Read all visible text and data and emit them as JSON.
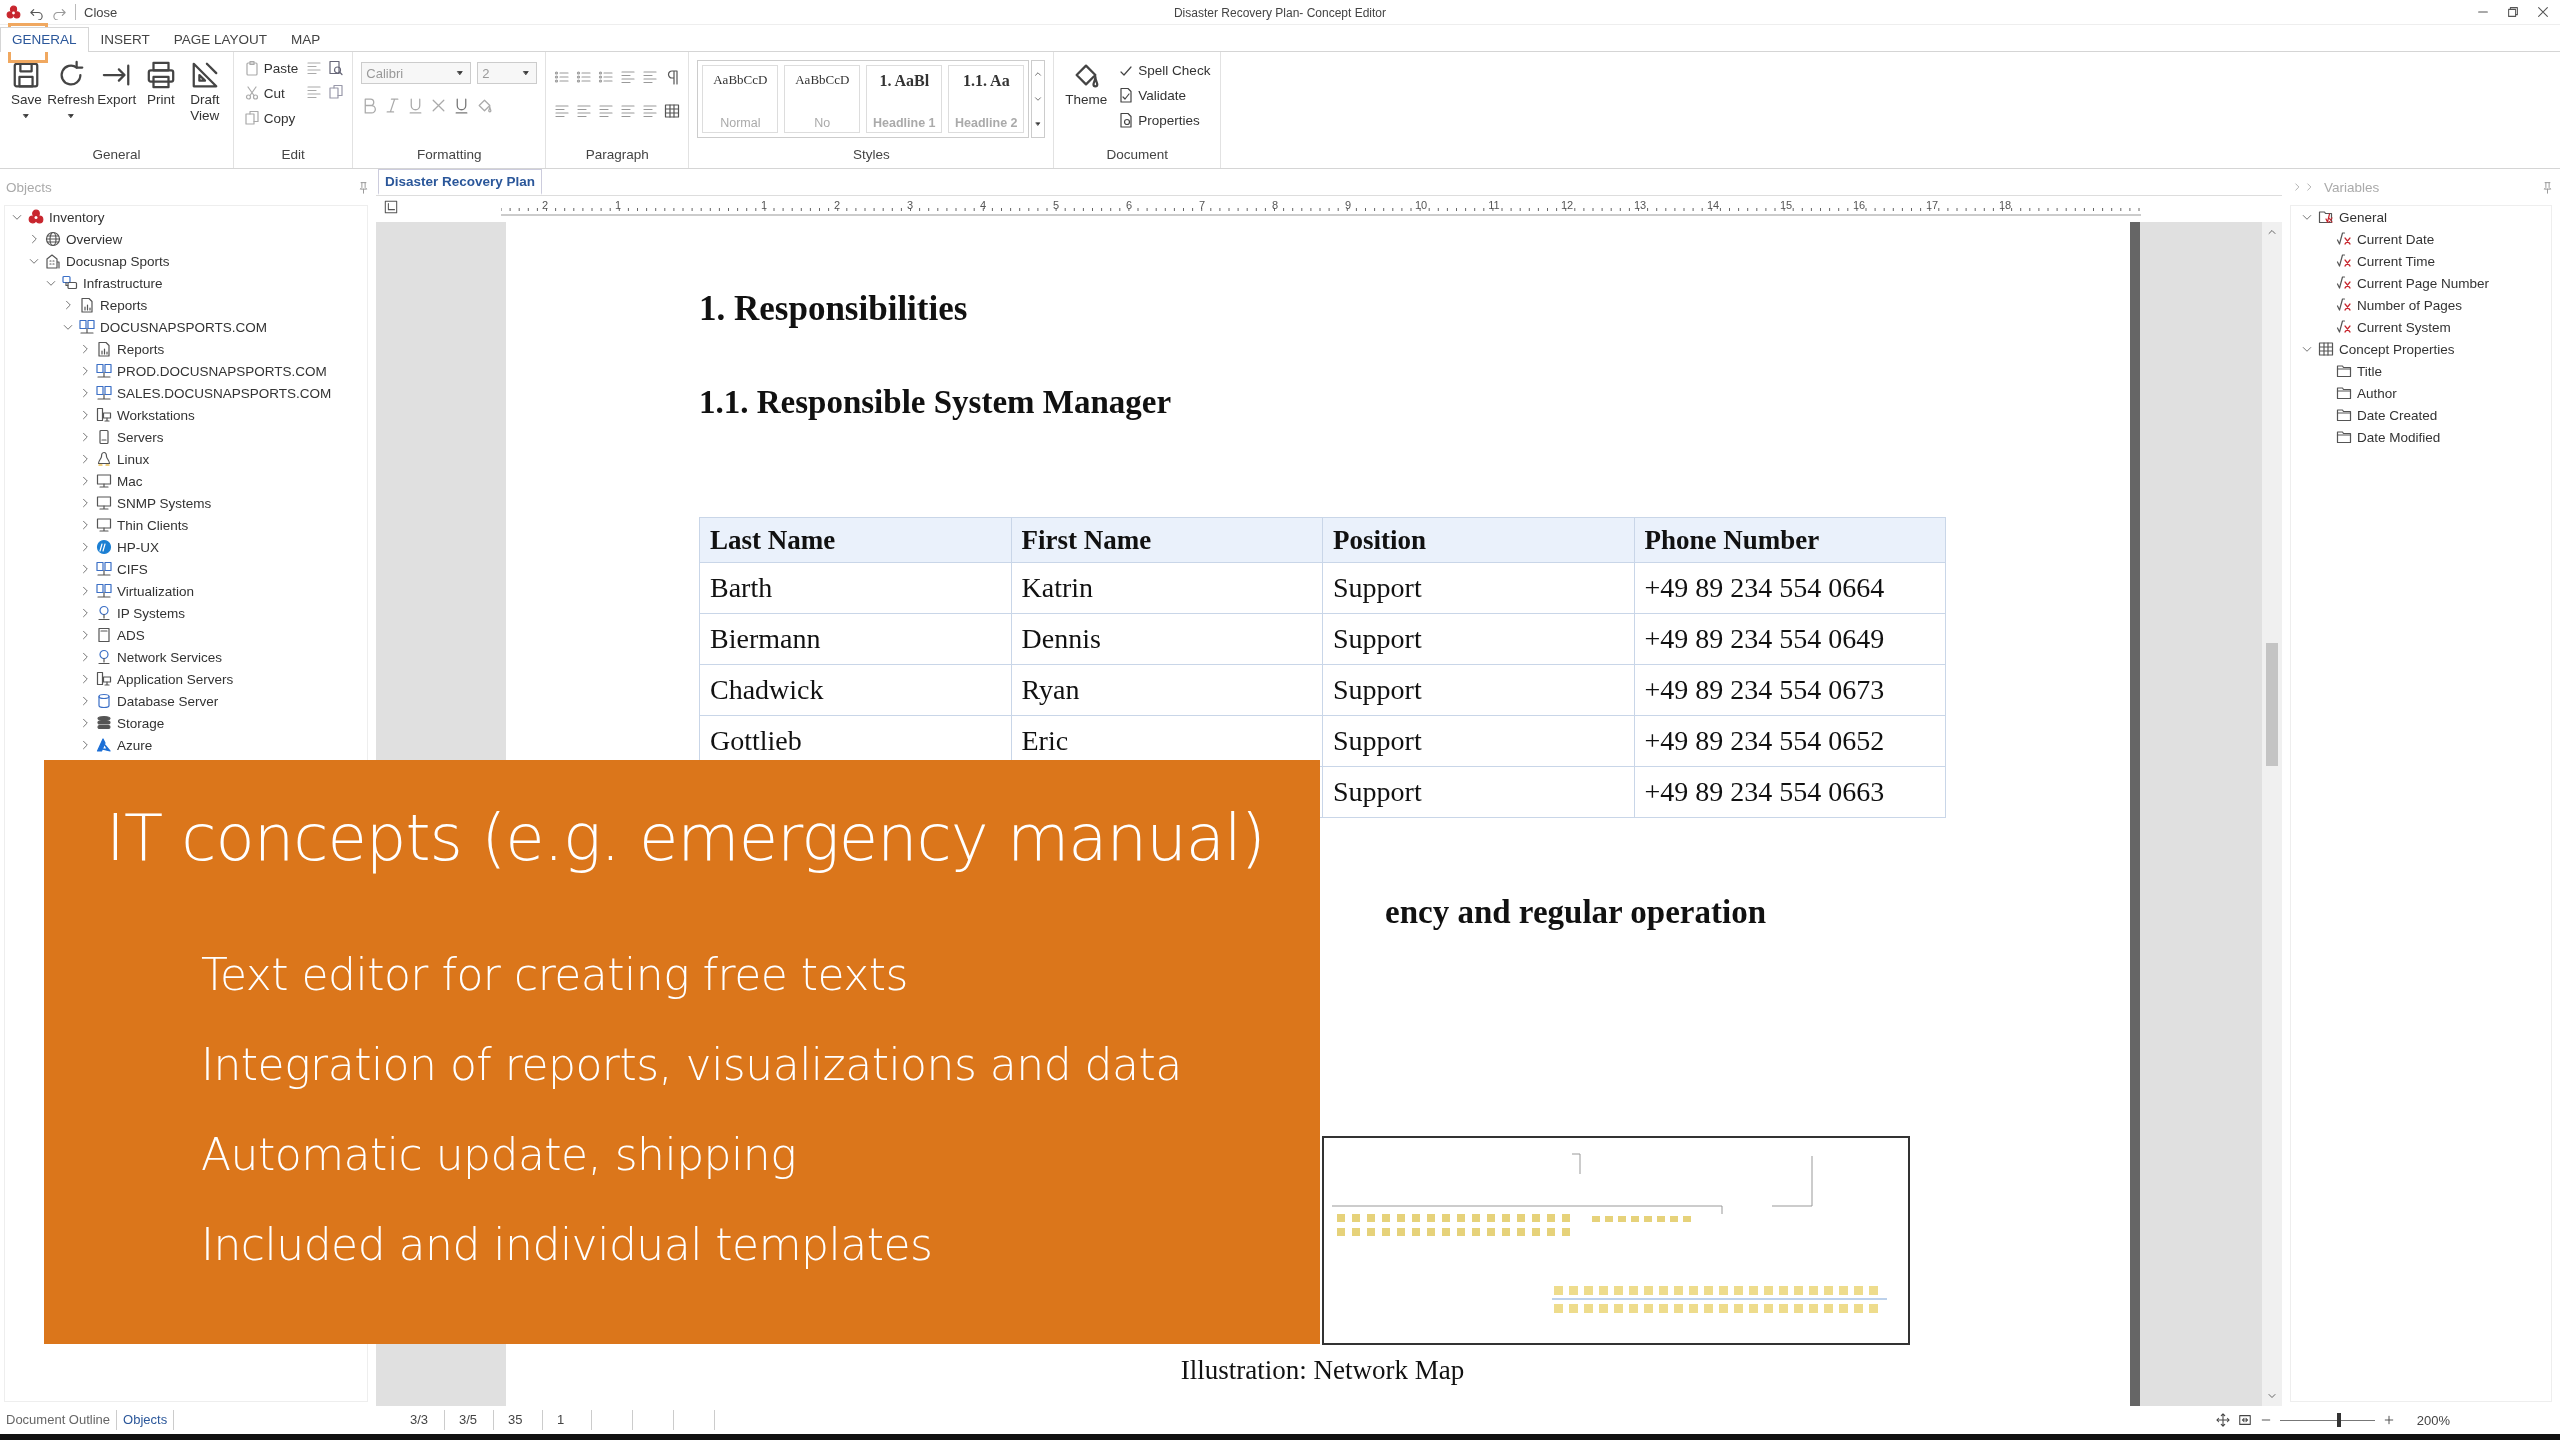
{
  "window": {
    "title": "Disaster Recovery Plan- Concept Editor",
    "quick_access": "Close"
  },
  "ribbon_tabs": [
    {
      "label": "GENERAL",
      "selected": true
    },
    {
      "label": "INSERT",
      "selected": false
    },
    {
      "label": "PAGE LAYOUT",
      "selected": false
    },
    {
      "label": "MAP",
      "selected": false
    }
  ],
  "ribbon": {
    "groups": [
      {
        "label": "General",
        "kind": "large",
        "items": [
          {
            "label": "Save",
            "kind": "save",
            "dropdown": true,
            "disabled": false
          },
          {
            "label": "Refresh",
            "kind": "refresh",
            "dropdown": true,
            "disabled": false
          },
          {
            "label": "Export",
            "kind": "export",
            "dropdown": false,
            "disabled": false
          },
          {
            "label": "Print",
            "kind": "print",
            "dropdown": false,
            "disabled": false
          },
          {
            "label": "Draft View",
            "kind": "draft",
            "dropdown": false,
            "disabled": false
          }
        ]
      },
      {
        "label": "Edit",
        "kind": "edit",
        "items": [
          {
            "label": "Paste",
            "kind": "paste",
            "disabled": true
          },
          {
            "label": "Cut",
            "kind": "cut",
            "disabled": true
          },
          {
            "label": "Copy",
            "kind": "copy",
            "disabled": true
          }
        ]
      },
      {
        "label": "Formatting",
        "kind": "format",
        "font": "Calibri",
        "size": "2",
        "disabled": true
      },
      {
        "label": "Paragraph",
        "kind": "paragraph"
      },
      {
        "label": "Styles",
        "kind": "styles",
        "items": [
          {
            "preview": "AaBbCcD",
            "label": "Normal",
            "bold": false
          },
          {
            "preview": "AaBbCcD",
            "label": "No",
            "bold": false
          },
          {
            "preview": "1. AaBl",
            "label": "Headline 1",
            "bold": true
          },
          {
            "preview": "1.1. Aa",
            "label": "Headline 2",
            "bold": true
          }
        ]
      },
      {
        "label": "Document",
        "kind": "document",
        "items": [
          {
            "label": "Theme",
            "kind": "theme"
          },
          {
            "label": "Spell Check",
            "kind": "spell"
          },
          {
            "label": "Validate",
            "kind": "validate"
          },
          {
            "label": "Properties",
            "kind": "properties"
          }
        ]
      }
    ]
  },
  "objects": {
    "title": "Objects",
    "items": [
      {
        "label": "Inventory",
        "kind": "root",
        "expanded": true,
        "children": [
          {
            "label": "Overview",
            "kind": "globe",
            "expanded": false
          },
          {
            "label": "Docusnap Sports",
            "kind": "building",
            "expanded": true,
            "children": [
              {
                "label": "Infrastructure",
                "kind": "network",
                "expanded": true,
                "children": [
                  {
                    "label": "Reports",
                    "kind": "report",
                    "expanded": false
                  },
                  {
                    "label": "DOCUSNAPSPORTS.COM",
                    "kind": "domain",
                    "expanded": true,
                    "children": [
                      {
                        "label": "Reports",
                        "kind": "report",
                        "expanded": false
                      },
                      {
                        "label": "PROD.DOCUSNAPSPORTS.COM",
                        "kind": "domain",
                        "expanded": false
                      },
                      {
                        "label": "SALES.DOCUSNAPSPORTS.COM",
                        "kind": "domain",
                        "expanded": false
                      },
                      {
                        "label": "Workstations",
                        "kind": "workstation",
                        "expanded": false
                      },
                      {
                        "label": "Servers",
                        "kind": "server",
                        "expanded": false
                      },
                      {
                        "label": "Linux",
                        "kind": "linux",
                        "expanded": false
                      },
                      {
                        "label": "Mac",
                        "kind": "monitor",
                        "expanded": false
                      },
                      {
                        "label": "SNMP Systems",
                        "kind": "monitor",
                        "expanded": false
                      },
                      {
                        "label": "Thin Clients",
                        "kind": "monitor",
                        "expanded": false
                      },
                      {
                        "label": "HP-UX",
                        "kind": "hp",
                        "expanded": false
                      },
                      {
                        "label": "CIFS",
                        "kind": "domain",
                        "expanded": false
                      },
                      {
                        "label": "Virtualization",
                        "kind": "domain",
                        "expanded": false
                      },
                      {
                        "label": "IP Systems",
                        "kind": "pin",
                        "expanded": false
                      },
                      {
                        "label": "ADS",
                        "kind": "ads",
                        "expanded": false
                      },
                      {
                        "label": "Network Services",
                        "kind": "pin",
                        "expanded": false
                      },
                      {
                        "label": "Application Servers",
                        "kind": "workstation",
                        "expanded": false
                      },
                      {
                        "label": "Database Server",
                        "kind": "database",
                        "expanded": false
                      },
                      {
                        "label": "Storage",
                        "kind": "storage",
                        "expanded": false
                      },
                      {
                        "label": "Azure",
                        "kind": "azure",
                        "expanded": false
                      }
                    ]
                  }
                ]
              }
            ]
          }
        ]
      }
    ]
  },
  "document_tab": {
    "label": "Disaster Recovery Plan",
    "selected": true
  },
  "ruler": {
    "labels": [
      "2",
      "1",
      "1",
      "2",
      "3",
      "4",
      "5",
      "6",
      "7",
      "8",
      "9",
      "10",
      "11",
      "12",
      "13",
      "14",
      "15",
      "16",
      "17",
      "18"
    ]
  },
  "document": {
    "heading_1": "1. Responsibilities",
    "heading_1_1": "1.1. Responsible System Manager",
    "table": {
      "columns": [
        "Last Name",
        "First Name",
        "Position",
        "Phone Number"
      ],
      "rows": [
        [
          "Barth",
          "Katrin",
          "Support",
          "+49 89 234 554 0664"
        ],
        [
          "Biermann",
          "Dennis",
          "Support",
          "+49 89 234 554 0649"
        ],
        [
          "Chadwick",
          "Ryan",
          "Support",
          "+49 89 234 554 0673"
        ],
        [
          "Gottlieb",
          "Eric",
          "Support",
          "+49 89 234 554 0652"
        ],
        [
          "",
          "",
          "Support",
          "+49 89 234 554 0663"
        ]
      ]
    },
    "heading_2_visible": "ency and regular operation",
    "caption": "Illustration: Network Map"
  },
  "variables": {
    "title": "Variables",
    "items": [
      {
        "label": "General",
        "kind": "general",
        "expanded": true,
        "children": [
          {
            "label": "Current Date",
            "kind": "function"
          },
          {
            "label": "Current Time",
            "kind": "function"
          },
          {
            "label": "Current Page Number",
            "kind": "function"
          },
          {
            "label": "Number of Pages",
            "kind": "function"
          },
          {
            "label": "Current System",
            "kind": "function"
          }
        ]
      },
      {
        "label": "Concept Properties",
        "kind": "table",
        "expanded": true,
        "children": [
          {
            "label": "Title",
            "kind": "folder"
          },
          {
            "label": "Author",
            "kind": "folder"
          },
          {
            "label": "Date Created",
            "kind": "folder"
          },
          {
            "label": "Date Modified",
            "kind": "folder"
          }
        ]
      }
    ]
  },
  "status_bar": {
    "pane_tabs": [
      {
        "label": "Document Outline",
        "selected": false
      },
      {
        "label": "Objects",
        "selected": true
      }
    ],
    "counters": [
      "3/3",
      "3/5",
      "35",
      "1"
    ],
    "zoom": {
      "level": 0.62,
      "reading": "200%"
    }
  },
  "overlay": {
    "title": "IT concepts (e.g. emergency manual)",
    "bullets": [
      "Text editor for creating free texts",
      "Integration of reports, visualizations and data",
      "Automatic update, shipping",
      "Included and individual templates"
    ]
  }
}
